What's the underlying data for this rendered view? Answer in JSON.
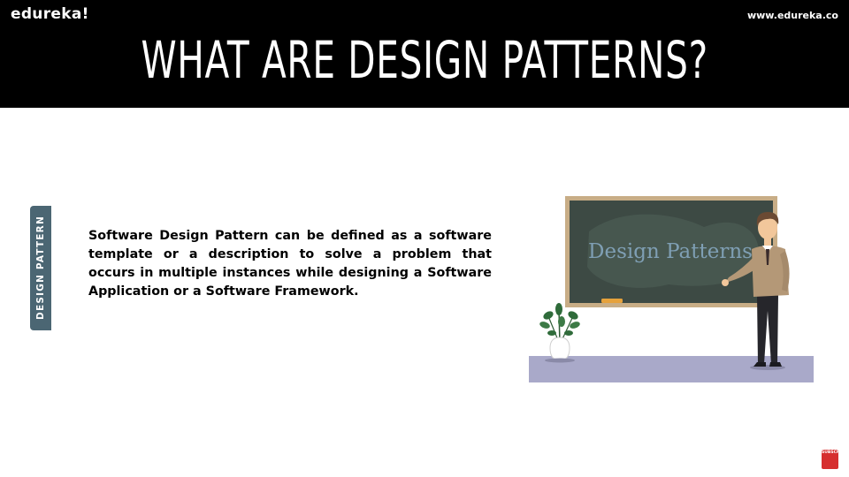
{
  "header": {
    "logo": "edureka!",
    "site_url": "www.edureka.co",
    "title": "WHAT ARE DESIGN PATTERNS?"
  },
  "side_tab": {
    "label": "DESIGN PATTERN"
  },
  "content": {
    "description": "Software Design Pattern can be defined as a software template or a description to solve a problem that occurs in multiple instances while designing a Software Application or a Software Framework."
  },
  "illustration": {
    "board_text": "Design Patterns",
    "icons": [
      "chalkboard",
      "teacher",
      "potted-plant"
    ],
    "colors": {
      "board": "#3d4a44",
      "frame": "#c8ad86",
      "floor": "#a9a9c9",
      "jacket": "#b49877"
    }
  },
  "subscribe_button": {
    "label": "SUBSCRIBE",
    "color": "#d62f2f"
  },
  "colors": {
    "header_bg": "#000000",
    "tab_bg": "#4b6673"
  }
}
